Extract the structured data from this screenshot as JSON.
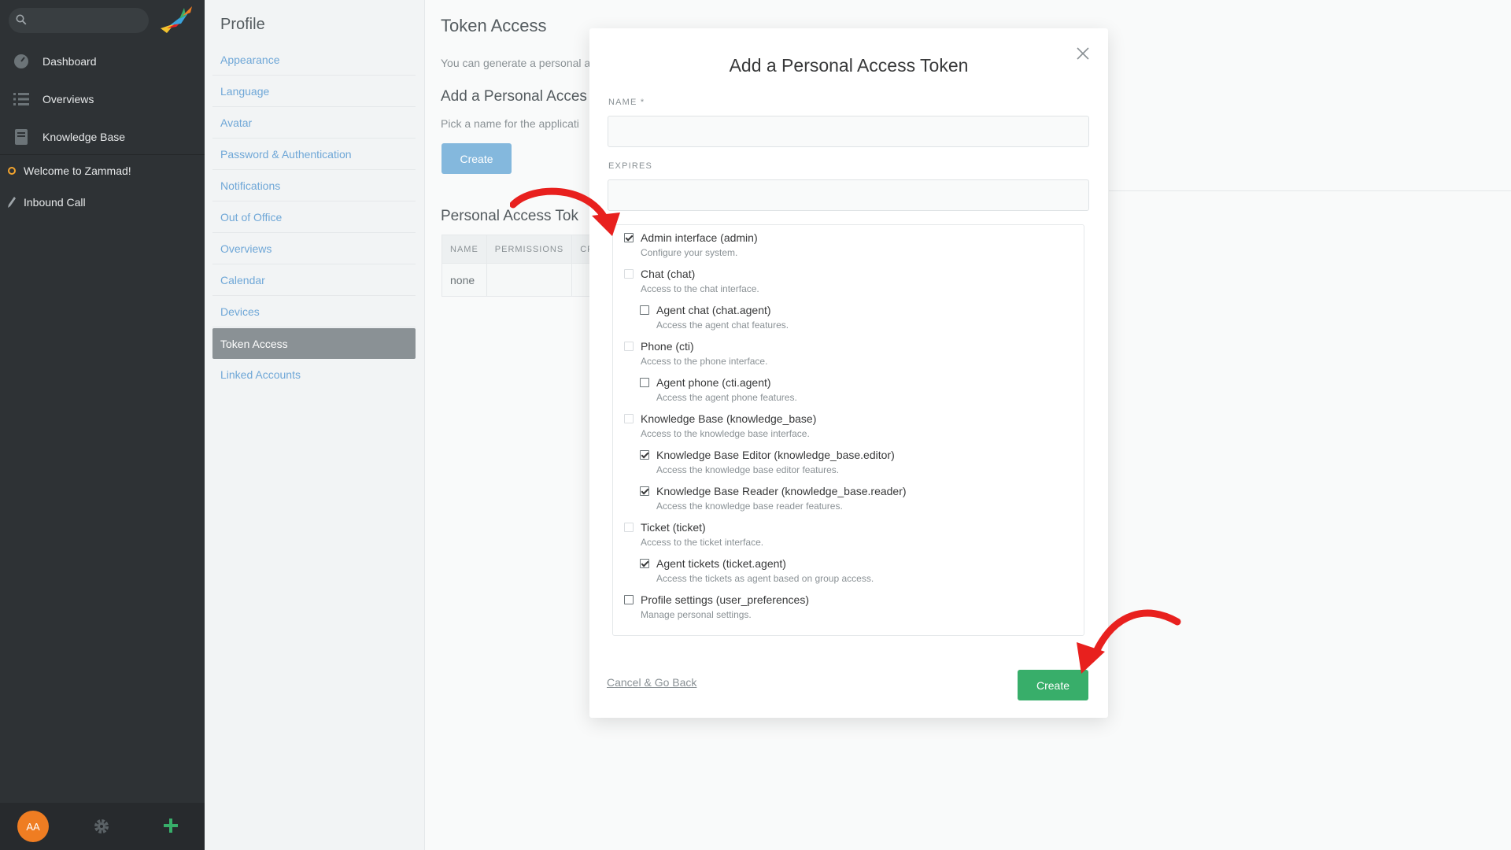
{
  "nav": {
    "search_placeholder": "",
    "items": [
      {
        "label": "Dashboard",
        "icon": "dashboard-icon"
      },
      {
        "label": "Overviews",
        "icon": "list-icon"
      },
      {
        "label": "Knowledge Base",
        "icon": "book-icon"
      }
    ],
    "tasks": [
      {
        "label": "Welcome to Zammad!",
        "icon": "status-dot-icon"
      },
      {
        "label": "Inbound Call",
        "icon": "pen-icon"
      }
    ],
    "avatar_initials": "AA",
    "colors": {
      "background": "#2e3235",
      "avatar": "#ef7d22",
      "plus": "#38ae6a"
    }
  },
  "profile": {
    "title": "Profile",
    "menu": [
      "Appearance",
      "Language",
      "Avatar",
      "Password & Authentication",
      "Notifications",
      "Out of Office",
      "Overviews",
      "Calendar",
      "Devices",
      "Token Access",
      "Linked Accounts"
    ],
    "active": "Token Access"
  },
  "main": {
    "title": "Token Access",
    "description": "You can generate a personal a",
    "add_heading": "Add a Personal Acces",
    "add_description": "Pick a name for the applicati",
    "create_label": "Create",
    "tokens_heading": "Personal Access Tok",
    "table_headers": [
      "NAME",
      "PERMISSIONS",
      "CRE"
    ],
    "table_rows": [
      [
        "none",
        "",
        ""
      ]
    ]
  },
  "modal": {
    "title": "Add a Personal Access Token",
    "name_label": "NAME *",
    "name_value": "",
    "expires_label": "EXPIRES",
    "expires_value": "",
    "permissions": [
      {
        "label": "Admin interface (admin)",
        "note": "Configure your system.",
        "checked": true,
        "disabled": false,
        "level": 0
      },
      {
        "label": "Chat (chat)",
        "note": "Access to the chat interface.",
        "checked": false,
        "disabled": true,
        "level": 0
      },
      {
        "label": "Agent chat (chat.agent)",
        "note": "Access the agent chat features.",
        "checked": false,
        "disabled": false,
        "level": 1
      },
      {
        "label": "Phone (cti)",
        "note": "Access to the phone interface.",
        "checked": false,
        "disabled": true,
        "level": 0
      },
      {
        "label": "Agent phone (cti.agent)",
        "note": "Access the agent phone features.",
        "checked": false,
        "disabled": false,
        "level": 1
      },
      {
        "label": "Knowledge Base (knowledge_base)",
        "note": "Access to the knowledge base interface.",
        "checked": false,
        "disabled": true,
        "level": 0
      },
      {
        "label": "Knowledge Base Editor (knowledge_base.editor)",
        "note": "Access the knowledge base editor features.",
        "checked": true,
        "disabled": false,
        "level": 1
      },
      {
        "label": "Knowledge Base Reader (knowledge_base.reader)",
        "note": "Access the knowledge base reader features.",
        "checked": true,
        "disabled": false,
        "level": 1
      },
      {
        "label": "Ticket (ticket)",
        "note": "Access to the ticket interface.",
        "checked": false,
        "disabled": true,
        "level": 0
      },
      {
        "label": "Agent tickets (ticket.agent)",
        "note": "Access the tickets as agent based on group access.",
        "checked": true,
        "disabled": false,
        "level": 1
      },
      {
        "label": "Profile settings (user_preferences)",
        "note": "Manage personal settings.",
        "checked": false,
        "disabled": false,
        "level": 0
      }
    ],
    "cancel_label": "Cancel & Go Back",
    "create_label": "Create",
    "colors": {
      "create_button": "#38ae6a",
      "annotation_arrow": "#e8201e"
    }
  }
}
